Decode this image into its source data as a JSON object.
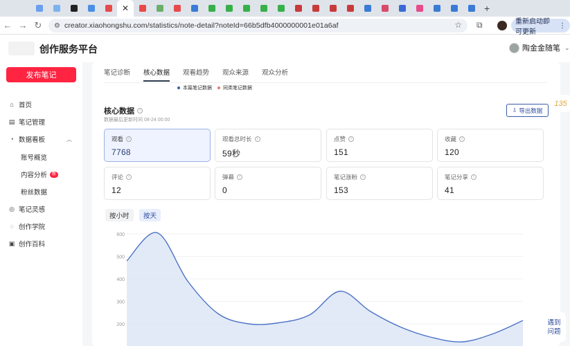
{
  "browser": {
    "tab_colors": [
      "#6a9ff0",
      "#7ab3f0",
      "#222222",
      "#4a8fe6",
      "#e84a4a",
      "#ffffff",
      "#e84a4a",
      "#6ab06a",
      "#e84a4a",
      "#3a7bd5",
      "#37b04a",
      "#37b04a",
      "#37b04a",
      "#37b04a",
      "#37b04a",
      "#c83a3a",
      "#c83a3a",
      "#c83a3a",
      "#c83a3a",
      "#3a7bd5",
      "#d84a6a",
      "#3a6bd5",
      "#e84a8a",
      "#3a7bd5",
      "#3a7bd5",
      "#3a7bd5"
    ],
    "active_tab_index": 5,
    "url": "creator.xiaohongshu.com/statistics/note-detail?noteId=66b5dfb4000000001e01a6af",
    "update_label": "重新启动即可更新"
  },
  "header": {
    "title": "创作服务平台",
    "username": "陶金金随笔"
  },
  "sidebar": {
    "publish_label": "发布笔记",
    "items": [
      {
        "label": "首页",
        "icon": "home-icon",
        "glyph": "⌂"
      },
      {
        "label": "笔记管理",
        "icon": "note-icon",
        "glyph": "▤"
      },
      {
        "label": "数据看板",
        "icon": "dashboard-icon",
        "glyph": "◔"
      },
      {
        "label": "账号概览"
      },
      {
        "label": "内容分析",
        "badge": "新"
      },
      {
        "label": "粉丝数据"
      },
      {
        "label": "笔记灵感",
        "icon": "inspiration-icon",
        "glyph": "◎"
      },
      {
        "label": "创作学院",
        "icon": "academy-icon",
        "glyph": "◌"
      },
      {
        "label": "创作百科",
        "icon": "wiki-icon",
        "glyph": "▣"
      }
    ]
  },
  "main": {
    "tabs": [
      "笔记诊断",
      "核心数据",
      "观看趋势",
      "观众来源",
      "观众分析"
    ],
    "active_tab": 1,
    "legend": [
      {
        "label": "本篇笔记数据",
        "color": "#3d5ea8"
      },
      {
        "label": "同类笔记数据",
        "color": "#e57a6a"
      }
    ],
    "section_title": "核心数据",
    "section_subtitle": "数据最后更新时间 08-24 00:00",
    "export_label": "导出数据",
    "metrics": [
      {
        "label": "观看",
        "value": "7768",
        "selected": true
      },
      {
        "label": "观看总时长",
        "value": "59秒"
      },
      {
        "label": "点赞",
        "value": "151"
      },
      {
        "label": "收藏",
        "value": "120"
      },
      {
        "label": "评论",
        "value": "12"
      },
      {
        "label": "弹幕",
        "value": "0"
      },
      {
        "label": "笔记涨粉",
        "value": "153"
      },
      {
        "label": "笔记分享",
        "value": "41"
      }
    ],
    "toggle": {
      "hour": "按小时",
      "day": "按天"
    }
  },
  "chart_data": {
    "type": "area",
    "yticks": [
      "600",
      "500",
      "400",
      "300",
      "200"
    ],
    "y_tick_values": [
      600,
      500,
      400,
      300,
      200
    ],
    "series": [
      {
        "values": [
          480,
          605,
          390,
          245,
          200,
          205,
          240,
          345,
          255,
          185,
          140,
          120,
          155,
          215
        ]
      }
    ],
    "color": "#4a72c4",
    "fill": "#dde6f7"
  },
  "floating": {
    "side_glyph": "135",
    "help_label_1": "遇到",
    "help_label_2": "问题"
  }
}
